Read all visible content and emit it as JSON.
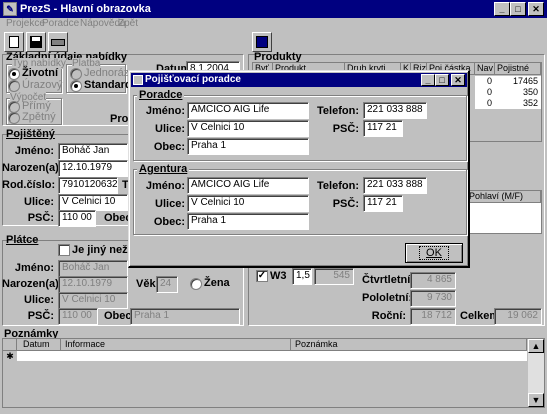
{
  "app": {
    "title": "PrezS - Hlavní obrazovka"
  },
  "menu": [
    "Projekce",
    "Poradce",
    "Nápověda",
    "Zpět"
  ],
  "basic": {
    "heading": "Základní údaje nabídky",
    "type_group": "Typ nabídky",
    "type_options": [
      "Životní",
      "Úrazový"
    ],
    "platba_group": "Platba",
    "platba_options": [
      "Jednoráz.",
      "Standardně"
    ],
    "vypocet_group": "Výpočet",
    "vypocet_options": [
      "Přímý",
      "Zpětný"
    ],
    "datum_label": "Datum:",
    "datum_value": "8.1.2004",
    "produkt_label": "Produkt"
  },
  "pojisteny": {
    "heading": "Pojištěný",
    "jmeno_label": "Jméno:",
    "jmeno": "Boháč Jan",
    "narozen_label": "Narozen(a):",
    "narozen": "12.10.1979",
    "rc_label": "Rod.číslo:",
    "rc": "7910120632",
    "t_label": "T",
    "ulice_label": "Ulice:",
    "ulice": "V Celnici 10",
    "psc_label": "PSČ:",
    "psc": "110 00",
    "obec_label": "Obec:"
  },
  "platce": {
    "heading": "Plátce",
    "jiny_label": "Je jiný než Poj",
    "jmeno_label": "Jméno:",
    "jmeno": "Boháč Jan",
    "narozen_label": "Narozen(a):",
    "narozen": "12.10.1979",
    "vek_label": "Věk:",
    "vek": "24",
    "zena_label": "Žena",
    "ulice_label": "Ulice:",
    "ulice": "V Celnici 10",
    "psc_label": "PSČ:",
    "psc": "110 00",
    "obec_label": "Obec:",
    "obec": "Praha 1"
  },
  "produkty": {
    "heading": "Produkty",
    "columns": [
      "Byť",
      "Produkt",
      "Druh kryti",
      "K",
      "Riz",
      "Poj.částka",
      "Nav",
      "Pojistné"
    ],
    "rows": [
      {
        "a": "0",
        "b": "17465"
      },
      {
        "a": "0",
        "b": "350"
      },
      {
        "a": "0",
        "b": "352"
      }
    ],
    "lower_col": "Pohlaví (M/F)"
  },
  "summary": {
    "w3_label": "W3",
    "w3_rate": "1,5",
    "w3_value": "545",
    "ctvrtletni_label": "Čtvrtletní:",
    "ctvrtletni": "4 865",
    "pololetni_label": "Pololetní:",
    "pololetni": "9 730",
    "rocni_label": "Roční:",
    "rocni": "18 712",
    "celkem_label": "Celkem:",
    "celkem": "19 062"
  },
  "poznamky": {
    "heading": "Poznámky",
    "columns": [
      "Datum",
      "Informace",
      "Poznámka"
    ],
    "new_row_marker": "✱"
  },
  "dialog": {
    "title": "Pojišťovací poradce",
    "poradce": {
      "heading": "Poradce",
      "jmeno_label": "Jméno:",
      "jmeno": "AMCICO AIG Life",
      "telefon_label": "Telefon:",
      "telefon": "221 033 888",
      "ulice_label": "Ulice:",
      "ulice": "V Celnici 10",
      "psc_label": "PSČ:",
      "psc": "117 21",
      "obec_label": "Obec:",
      "obec": "Praha 1"
    },
    "agentura": {
      "heading": "Agentura",
      "jmeno_label": "Jméno:",
      "jmeno": "AMCICO AIG Life",
      "telefon_label": "Telefon:",
      "telefon": "221 033 888",
      "ulice_label": "Ulice:",
      "ulice": "V Celnici 10",
      "psc_label": "PSČ:",
      "psc": "117 21",
      "obec_label": "Obec:",
      "obec": "Praha 1"
    },
    "ok_label": "OK"
  },
  "colors": {
    "titlebar": "#000080",
    "face": "#c0c0c0"
  }
}
